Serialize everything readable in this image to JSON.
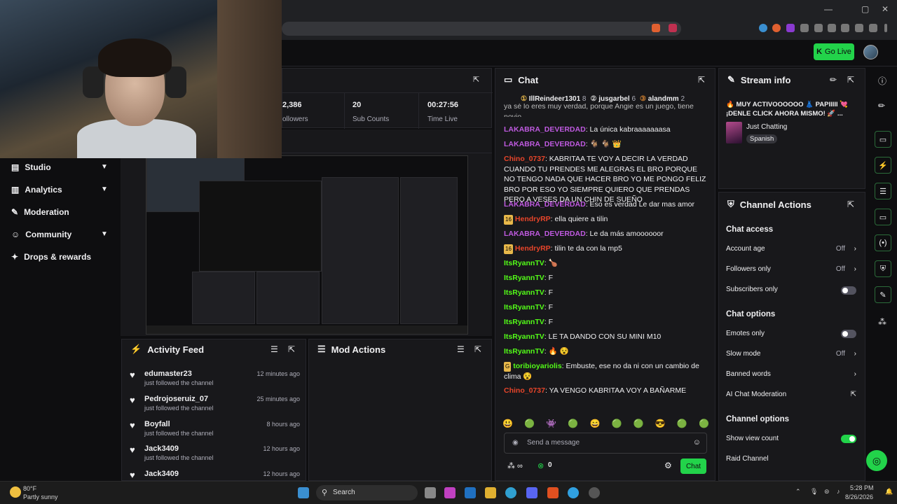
{
  "browser": {
    "window_controls": [
      "—",
      "▢",
      "✕"
    ]
  },
  "topbar": {
    "go_live_label": "Go Live"
  },
  "stats": {
    "items": [
      {
        "value": "2,386",
        "label": "ollowers"
      },
      {
        "value": "20",
        "label": "Sub Counts"
      },
      {
        "value": "00:27:56",
        "label": "Time Live"
      }
    ]
  },
  "leftnav": {
    "items": [
      {
        "label": "Studio",
        "icon": "studio-icon",
        "has_chevron": true
      },
      {
        "label": "Analytics",
        "icon": "analytics-icon",
        "has_chevron": true
      },
      {
        "label": "Moderation",
        "icon": "wrench-icon",
        "has_chevron": false
      },
      {
        "label": "Community",
        "icon": "community-icon",
        "has_chevron": true
      },
      {
        "label": "Drops & rewards",
        "icon": "gift-icon",
        "has_chevron": false
      }
    ]
  },
  "activity": {
    "title": "Activity Feed",
    "items": [
      {
        "name": "edumaster23",
        "sub": "just followed the channel",
        "time": "12 minutes ago"
      },
      {
        "name": "Pedrojoseruiz_07",
        "sub": "just followed the channel",
        "time": "25 minutes ago"
      },
      {
        "name": "Boyfall",
        "sub": "just followed the channel",
        "time": "8 hours ago"
      },
      {
        "name": "Jack3409",
        "sub": "just followed the channel",
        "time": "12 hours ago"
      },
      {
        "name": "Jack3409",
        "sub": "",
        "time": "12 hours ago"
      }
    ]
  },
  "modactions": {
    "title": "Mod Actions"
  },
  "chat": {
    "title": "Chat",
    "top_chatters": [
      {
        "name": "IllReindeer1301",
        "count": "8"
      },
      {
        "name": "jusgarbel",
        "count": "6"
      },
      {
        "name": "alandmm",
        "count": "2"
      }
    ],
    "partial_first_line": "ya sé lo eres muy verdad, porque Angie es un juego, tiene novio",
    "messages": [
      {
        "user": "LAKABRA_DEVERDAD",
        "color": "#bf5ae0",
        "text": "La única kabraaaaaaasa",
        "badge": ""
      },
      {
        "user": "LAKABRA_DEVERDAD",
        "color": "#bf5ae0",
        "text": "🐐 🐐 👑",
        "badge": ""
      },
      {
        "user": "Chino_0737",
        "color": "#e8452a",
        "text": "KABRITAA TE VOY A DECIR LA VERDAD CUANDO TU PRENDES ME ALEGRAS EL BRO PORQUE NO TENGO NADA QUE HACER BRO YO ME PONGO FELIZ BRO POR ESO YO SIEMPRE QUIERO QUE PRENDAS PERO A VESES DA UN CHIN DE SUEÑO",
        "badge": ""
      },
      {
        "user": "LAKABRA_DEVERDAD",
        "color": "#bf5ae0",
        "text": "Eso es verdad Le dar mas amor",
        "badge": ""
      },
      {
        "user": "HendryRP",
        "color": "#e8452a",
        "text": "ella quiere a tilin",
        "badge": "16"
      },
      {
        "user": "LAKABRA_DEVERDAD",
        "color": "#bf5ae0",
        "text": "Le da más amoooooor",
        "badge": ""
      },
      {
        "user": "HendryRP",
        "color": "#e8452a",
        "text": "tilin te da con la mp5",
        "badge": "16"
      },
      {
        "user": "ItsRyannTV",
        "color": "#53fc18",
        "text": "🍗",
        "badge": ""
      },
      {
        "user": "ItsRyannTV",
        "color": "#53fc18",
        "text": "F",
        "badge": ""
      },
      {
        "user": "ItsRyannTV",
        "color": "#53fc18",
        "text": "F",
        "badge": ""
      },
      {
        "user": "ItsRyannTV",
        "color": "#53fc18",
        "text": "F",
        "badge": ""
      },
      {
        "user": "ItsRyannTV",
        "color": "#53fc18",
        "text": "F",
        "badge": ""
      },
      {
        "user": "ItsRyannTV",
        "color": "#53fc18",
        "text": "LE TA DANDO CON SU MINI M10",
        "badge": ""
      },
      {
        "user": "ItsRyannTV",
        "color": "#53fc18",
        "text": "🔥 😵",
        "badge": ""
      },
      {
        "user": "toribioyariolis",
        "color": "#53fc18",
        "text": "Embuste, ese no da ni con un cambio de clima 😵",
        "badge": "G"
      },
      {
        "user": "Chino_0737",
        "color": "#e8452a",
        "text": "YA VENGO KABRITAA VOY A BAÑARME",
        "badge": ""
      }
    ],
    "input_placeholder": "Send a message",
    "points_value": "0",
    "send_label": "Chat"
  },
  "streaminfo": {
    "title": "Stream info",
    "stream_title": "🔥 MUY ACTIVOOOOOO 👗 PAPIIIII 💘 ¡DENLE CLICK AHORA MISMO! 🚀 ...",
    "category": "Just Chatting",
    "language": "Spanish"
  },
  "channelactions": {
    "title": "Channel Actions",
    "chat_access_title": "Chat access",
    "account_age": {
      "label": "Account age",
      "value": "Off"
    },
    "followers_only": {
      "label": "Followers only",
      "value": "Off"
    },
    "subscribers_only": {
      "label": "Subscribers only",
      "enabled": false
    },
    "chat_options_title": "Chat options",
    "emotes_only": {
      "label": "Emotes only",
      "enabled": false
    },
    "slow_mode": {
      "label": "Slow mode",
      "value": "Off"
    },
    "banned_words": {
      "label": "Banned words"
    },
    "ai_moderation": {
      "label": "AI Chat Moderation"
    },
    "channel_options_title": "Channel options",
    "show_view_count": {
      "label": "Show view count",
      "enabled": true
    },
    "raid_channel": {
      "label": "Raid Channel"
    }
  },
  "taskbar": {
    "weather_temp": "80°F",
    "weather_text": "Partly sunny",
    "search_label": "Search",
    "time": "5:28 PM",
    "date": "8/26/2026"
  },
  "colors": {
    "accent": "#22d34a",
    "bg": "#0e0e10",
    "panel": "#18181b"
  }
}
